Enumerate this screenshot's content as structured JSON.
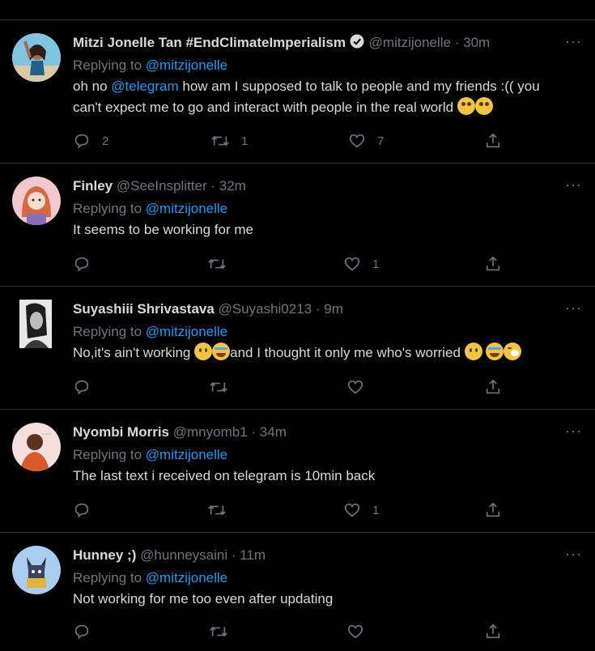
{
  "tweets": [
    {
      "name": "Mitzi Jonelle Tan #EndClimateImperialism",
      "verified": true,
      "handle": "@mitzijonelle",
      "time": "30m",
      "replying_prefix": "Replying to ",
      "replying_to": "",
      "text_lines": [
        {
          "before": "oh no ",
          "mention": "@telegram",
          "after": " how am I supposed to talk to people and my friends :(( you"
        },
        {
          "before": "can't expect me to go and interact with people in the real world",
          "mention": "",
          "after": ""
        }
      ],
      "replying_line": "@mitzijonelle",
      "emojis_line2": [
        "face-with-rolling-eyes",
        "face-with-rolling-eyes"
      ],
      "stats": {
        "replies": "2",
        "retweets": "1",
        "likes": "7"
      },
      "avatar_colors": [
        "#7fc4e0",
        "#3a2a22",
        "#c98f68"
      ]
    },
    {
      "name": "Finley",
      "handle": "@SeeInsplitter",
      "time": "32m",
      "replying_prefix": "Replying to ",
      "replying_to": "@mitzijonelle",
      "text": "It seems to be working for me",
      "stats": {
        "replies": "",
        "retweets": "",
        "likes": "1"
      },
      "avatar_colors": [
        "#f2c8cf",
        "#d9683f",
        "#f7dccf"
      ]
    },
    {
      "name": "Suyashiii Shrivastava",
      "handle": "@Suyashi0213",
      "time": "9m",
      "replying_prefix": "Replying to ",
      "replying_to": "@mitzijonelle",
      "text_a": "No,it's ain't working ",
      "text_b": "and I thought it only me who's worried ",
      "stats": {
        "replies": "",
        "retweets": "",
        "likes": ""
      },
      "avatar_colors": [
        "#e8e8e8",
        "#2a2a2a",
        "#9a9a9a"
      ]
    },
    {
      "name": "Nyombi Morris",
      "handle": "@mnyomb1",
      "time": "34m",
      "replying_prefix": "Replying to ",
      "replying_to": "@mitzijonelle",
      "text": "The last text i received on telegram is 10min back",
      "stats": {
        "replies": "",
        "retweets": "",
        "likes": "1"
      },
      "avatar_colors": [
        "#f4dfdc",
        "#5a3320",
        "#d85a2a"
      ]
    },
    {
      "name": "Hunney ;)",
      "handle": "@hunneysaini",
      "time": "11m",
      "replying_prefix": "Replying to ",
      "replying_to": "@mitzijonelle",
      "text": "Not working for me too even after updating",
      "stats": {
        "replies": "",
        "retweets": "",
        "likes": ""
      },
      "avatar_colors": [
        "#a9cdf0",
        "#2b2f45",
        "#e0b43c"
      ]
    }
  ],
  "more_glyph": "···",
  "dot_sep": " · ",
  "icons": {
    "reply": "reply-icon",
    "retweet": "retweet-icon",
    "like": "heart-icon",
    "share": "share-icon",
    "verified": "verified-badge-icon",
    "more": "more-options-icon"
  },
  "colors": {
    "background": "#000000",
    "text": "#d9d9d9",
    "muted": "#6e767d",
    "link": "#1d9bf0",
    "divider": "#2f3336"
  }
}
